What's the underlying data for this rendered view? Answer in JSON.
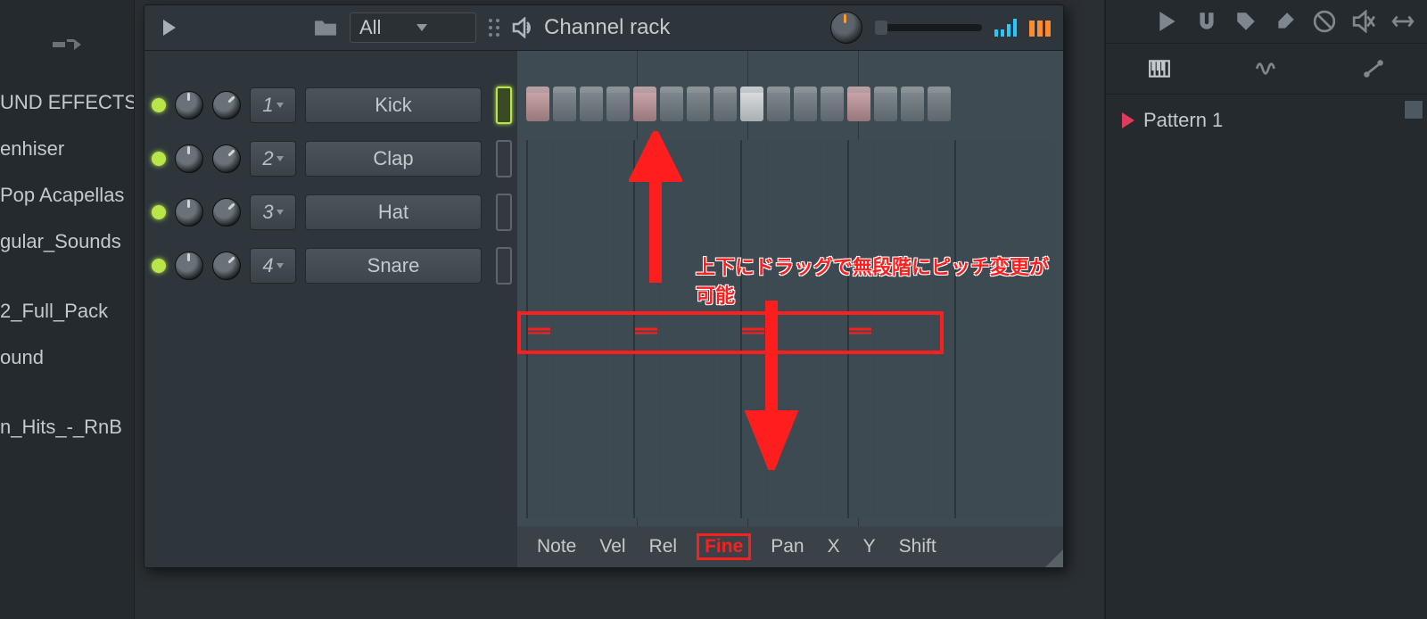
{
  "browser": {
    "items": [
      "UND EFFECTS",
      "enhiser",
      "Pop Acapellas",
      "gular_Sounds",
      "",
      "2_Full_Pack",
      "ound",
      "",
      "n_Hits_-_RnB"
    ]
  },
  "header": {
    "filter_label": "All",
    "title": "Channel rack"
  },
  "channels": [
    {
      "num": "1",
      "name": "Kick",
      "selected": true
    },
    {
      "num": "2",
      "name": "Clap",
      "selected": false
    },
    {
      "num": "3",
      "name": "Hat",
      "selected": false
    },
    {
      "num": "4",
      "name": "Snare",
      "selected": false
    }
  ],
  "steps": {
    "count": 16,
    "accent1": [
      1,
      5,
      9,
      13
    ],
    "accent2": [
      9
    ]
  },
  "tabs": [
    "Note",
    "Vel",
    "Rel",
    "Fine",
    "Pan",
    "X",
    "Y",
    "Shift"
  ],
  "active_tab": "Fine",
  "annotation": "上下にドラッグで無段階にピッチ変更が可能",
  "picker": {
    "pattern": "Pattern 1"
  }
}
